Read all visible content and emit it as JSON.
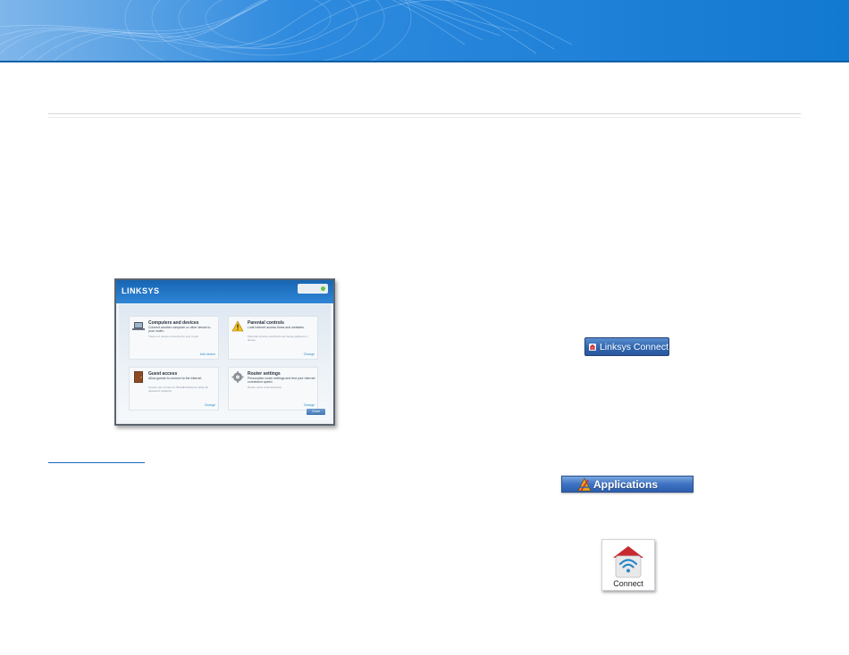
{
  "colors": {
    "banner": "#1f86dc",
    "link": "#1a66c2",
    "card_link": "#2b8fc7",
    "button_blue": "#2f64ad"
  },
  "dashboard": {
    "logo": "LINKSYS",
    "status": "",
    "cards": [
      {
        "title": "Computers and devices",
        "desc": "Connect another computer or other device to your router.",
        "note": "There is 1 device connected to your router.",
        "link": "Add device",
        "icon": "laptop-icon"
      },
      {
        "title": "Parental controls",
        "desc": "Limit Internet access times and websites.",
        "note": "Parental controls restrictions are being applied to 1 device.",
        "link": "Change",
        "icon": "warning-icon"
      },
      {
        "title": "Guest access",
        "desc": "Allow guests to connect to the Internet",
        "note": "Guests can connect to: BroadbandGuest using the password: aplachat",
        "link": "Change",
        "icon": "door-icon"
      },
      {
        "title": "Router settings",
        "desc": "Personalize router settings and test your Internet connection speed.",
        "note": "Router name is RouterSetup",
        "link": "Change",
        "icon": "gear-icon"
      }
    ],
    "button": "Close"
  },
  "linksys_connect_button": {
    "label": "Linksys Connect",
    "icon": "router-home-icon"
  },
  "applications_bar": {
    "label": "Applications",
    "icon": "applications-icon"
  },
  "connect_app": {
    "label": "Connect",
    "icon": "wifi-home-icon"
  }
}
